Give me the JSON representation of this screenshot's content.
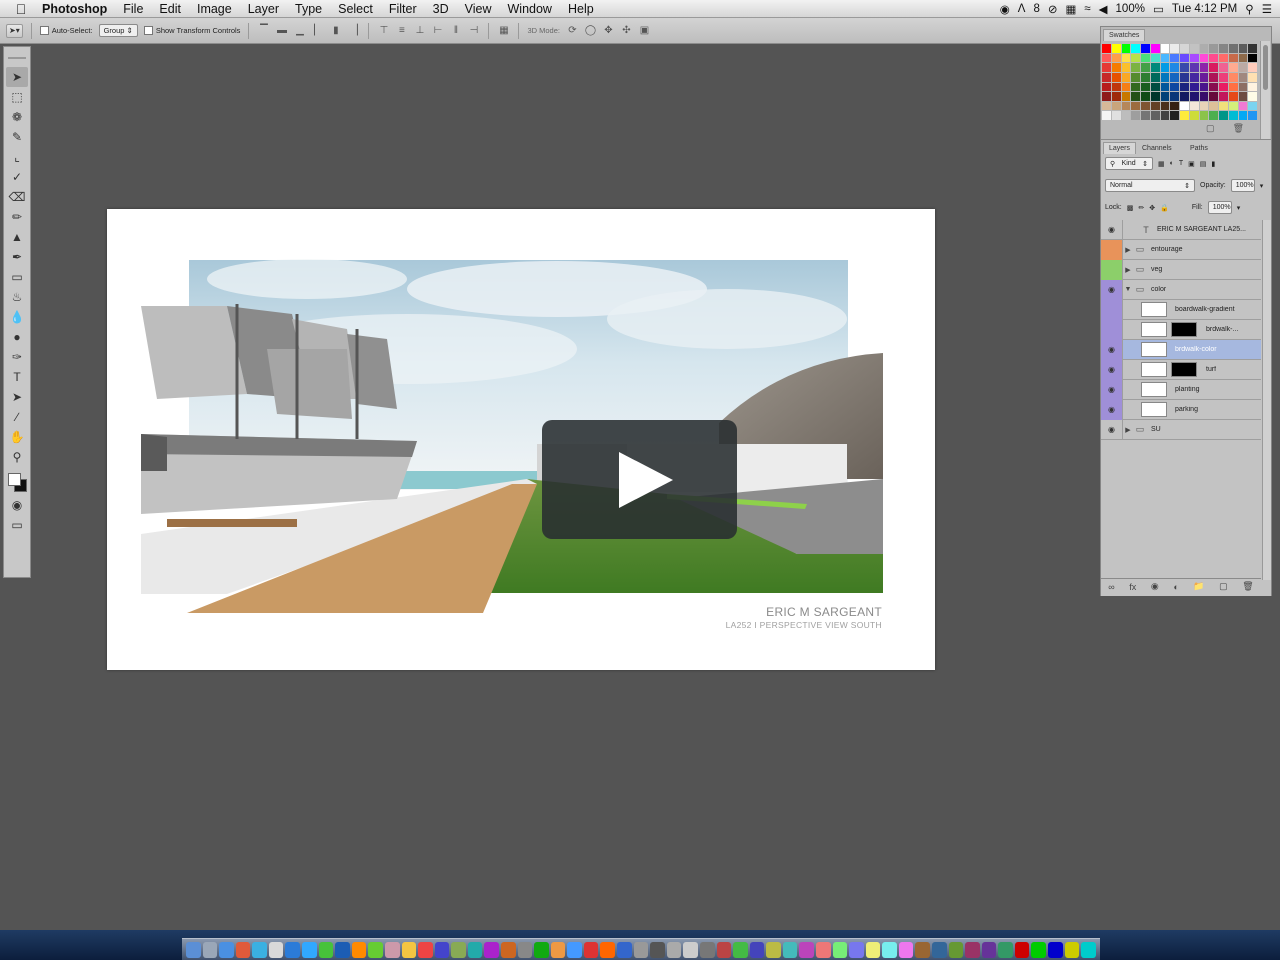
{
  "menubar": {
    "apple": "",
    "app_name": "Photoshop",
    "items": [
      "File",
      "Edit",
      "Image",
      "Layer",
      "Type",
      "Select",
      "Filter",
      "3D",
      "View",
      "Window",
      "Help"
    ],
    "status_number": "8",
    "battery": "100%",
    "clock": "Tue 4:12 PM"
  },
  "options_bar": {
    "auto_select_label": "Auto-Select:",
    "auto_select_target": "Group",
    "show_transform_label": "Show Transform Controls",
    "mode_3d_label": "3D Mode:"
  },
  "document": {
    "credit_name": "ERIC M SARGEANT",
    "credit_subtitle": "LA252 I PERSPECTIVE VIEW SOUTH"
  },
  "swatches": {
    "tab_label": "Swatches",
    "colors": [
      "#ff0000",
      "#ffff00",
      "#00ff00",
      "#00ffff",
      "#0000ff",
      "#ff00ff",
      "#ffffff",
      "#ebebeb",
      "#d6d6d6",
      "#c2c2c2",
      "#adadad",
      "#999999",
      "#858585",
      "#707070",
      "#5c5c5c",
      "#333333",
      "#ff5a5a",
      "#ff9e4a",
      "#ffe14a",
      "#b7e14a",
      "#4ae17a",
      "#4ae1c9",
      "#4ab7ff",
      "#4a7aff",
      "#6a4aff",
      "#a84aff",
      "#ff4ad7",
      "#ff4a8e",
      "#ff6a6a",
      "#c86a4a",
      "#8e6a4a",
      "#000000",
      "#e53935",
      "#f57c00",
      "#fbc02d",
      "#7cb342",
      "#43a047",
      "#00897b",
      "#039be5",
      "#1e88e5",
      "#3949ab",
      "#5e35b1",
      "#8e24aa",
      "#d81b60",
      "#f06292",
      "#ffab91",
      "#bcaaa4",
      "#ffccbc",
      "#c62828",
      "#e65100",
      "#f9a825",
      "#558b2f",
      "#2e7d32",
      "#00695c",
      "#0277bd",
      "#1565c0",
      "#283593",
      "#4527a0",
      "#6a1b9a",
      "#ad1457",
      "#ec407a",
      "#ff8a65",
      "#a1887f",
      "#ffe0b2",
      "#b71c1c",
      "#bf360c",
      "#f57f17",
      "#33691e",
      "#1b5e20",
      "#004d40",
      "#01579b",
      "#0d47a1",
      "#1a237e",
      "#311b92",
      "#4a148c",
      "#880e4f",
      "#e91e63",
      "#ff7043",
      "#8d6e63",
      "#fff3e0",
      "#8e1b1b",
      "#9e2a0a",
      "#c77800",
      "#255016",
      "#124a17",
      "#00352c",
      "#014178",
      "#0a3679",
      "#131a60",
      "#23146e",
      "#380f6a",
      "#660a3b",
      "#c2185b",
      "#e64a19",
      "#6d4c41",
      "#fffde7",
      "#d7b899",
      "#c9a57c",
      "#b5875a",
      "#9c6c3f",
      "#7f5532",
      "#634126",
      "#4a301c",
      "#362214",
      "#ffffff",
      "#f2e6d9",
      "#e8d4b8",
      "#ddc098",
      "#f1e07a",
      "#d4f07a",
      "#f07ad4",
      "#7ad4f0",
      "#f5f5f5",
      "#e0e0e0",
      "#bdbdbd",
      "#9e9e9e",
      "#757575",
      "#616161",
      "#424242",
      "#212121",
      "#ffeb3b",
      "#cddc39",
      "#8bc34a",
      "#4caf50",
      "#009688",
      "#00bcd4",
      "#03a9f4",
      "#2196f3"
    ]
  },
  "layers_panel": {
    "tabs": [
      "Layers",
      "Channels",
      "Paths"
    ],
    "filter_kind": "Kind",
    "blend_mode": "Normal",
    "opacity_label": "Opacity:",
    "opacity_value": "100%",
    "lock_label": "Lock:",
    "fill_label": "Fill:",
    "fill_value": "100%",
    "layers": [
      {
        "name": "ERIC M SARGEANT LA25...",
        "kind": "text",
        "visible": true,
        "color": ""
      },
      {
        "name": "entourage",
        "kind": "group",
        "visible": false,
        "color": "#e8935a"
      },
      {
        "name": "veg",
        "kind": "group",
        "visible": false,
        "color": "#8ccf6a"
      },
      {
        "name": "color",
        "kind": "group-open",
        "visible": true,
        "color": "#9f8fd8"
      },
      {
        "name": "boardwalk-gradient",
        "kind": "pixel",
        "visible": false,
        "color": "#9f8fd8"
      },
      {
        "name": "brdwalk-...",
        "kind": "masked",
        "visible": false,
        "color": "#9f8fd8"
      },
      {
        "name": "brdwalk-color",
        "kind": "pixel",
        "visible": true,
        "color": "#9f8fd8",
        "selected": true
      },
      {
        "name": "turf",
        "kind": "masked",
        "visible": true,
        "color": "#9f8fd8"
      },
      {
        "name": "planting",
        "kind": "pixel",
        "visible": true,
        "color": "#9f8fd8"
      },
      {
        "name": "parking",
        "kind": "pixel",
        "visible": true,
        "color": "#9f8fd8"
      },
      {
        "name": "SU",
        "kind": "group",
        "visible": true,
        "color": ""
      }
    ]
  }
}
